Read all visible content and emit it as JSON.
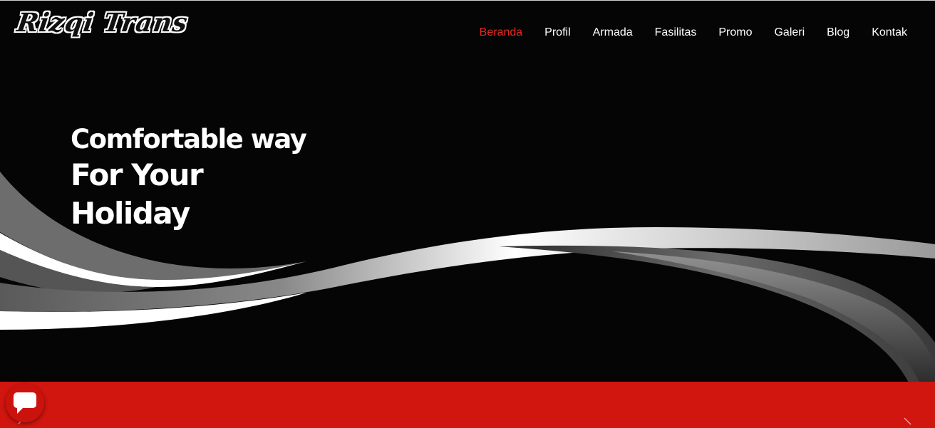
{
  "header": {
    "logo_text": "Rizqi Trans",
    "nav": [
      {
        "label": "Beranda",
        "active": true
      },
      {
        "label": "Profil"
      },
      {
        "label": "Armada"
      },
      {
        "label": "Fasilitas"
      },
      {
        "label": "Promo"
      },
      {
        "label": "Galeri"
      },
      {
        "label": "Blog"
      },
      {
        "label": "Kontak"
      }
    ]
  },
  "hero": {
    "line1": "Comfortable way",
    "line2": "For Your",
    "line3": "Holiday"
  },
  "colors": {
    "hero_bg": "#050505",
    "accent_red": "#d1150f",
    "nav_active": "#e52a20",
    "text": "#ffffff"
  },
  "icons": {
    "chat": "chat-bubble-icon",
    "prev": "chevron-left-icon",
    "next": "chevron-right-icon"
  }
}
